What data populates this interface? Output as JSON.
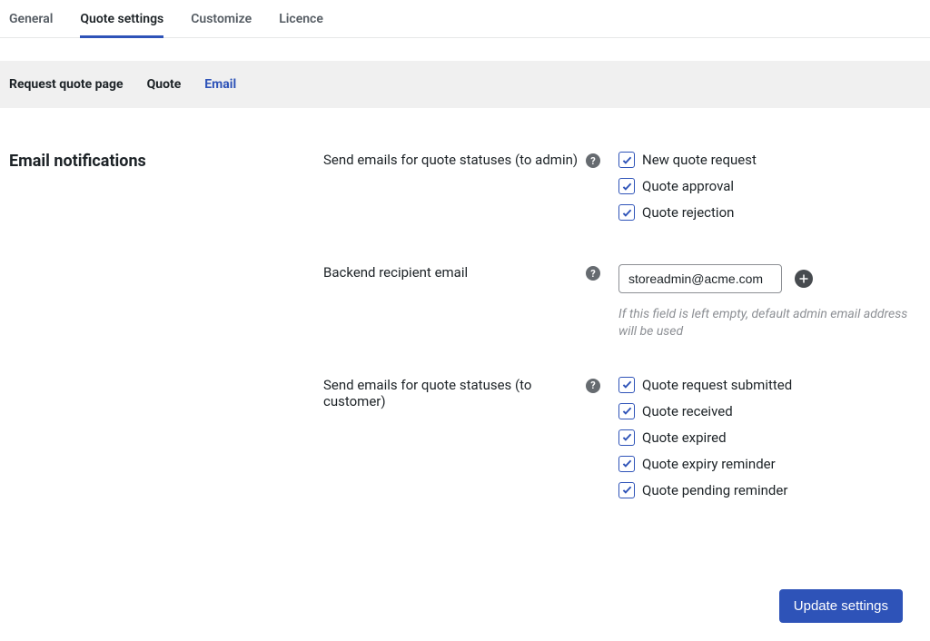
{
  "primary_tabs": {
    "general": "General",
    "quote_settings": "Quote settings",
    "customize": "Customize",
    "licence": "Licence"
  },
  "secondary_tabs": {
    "request_quote_page": "Request quote page",
    "quote": "Quote",
    "email": "Email"
  },
  "section": {
    "title": "Email notifications"
  },
  "fields": {
    "admin_statuses": {
      "label": "Send emails for quote statuses (to admin)",
      "options": {
        "new_request": "New quote request",
        "approval": "Quote approval",
        "rejection": "Quote rejection"
      }
    },
    "backend_email": {
      "label": "Backend recipient email",
      "value": "storeadmin@acme.com",
      "helper": "If this field is left empty, default admin email address will be used"
    },
    "customer_statuses": {
      "label": "Send emails for quote statuses (to customer)",
      "options": {
        "submitted": "Quote request submitted",
        "received": "Quote received",
        "expired": "Quote expired",
        "expiry_reminder": "Quote expiry reminder",
        "pending_reminder": "Quote pending reminder"
      }
    }
  },
  "footer": {
    "update_label": "Update settings"
  }
}
